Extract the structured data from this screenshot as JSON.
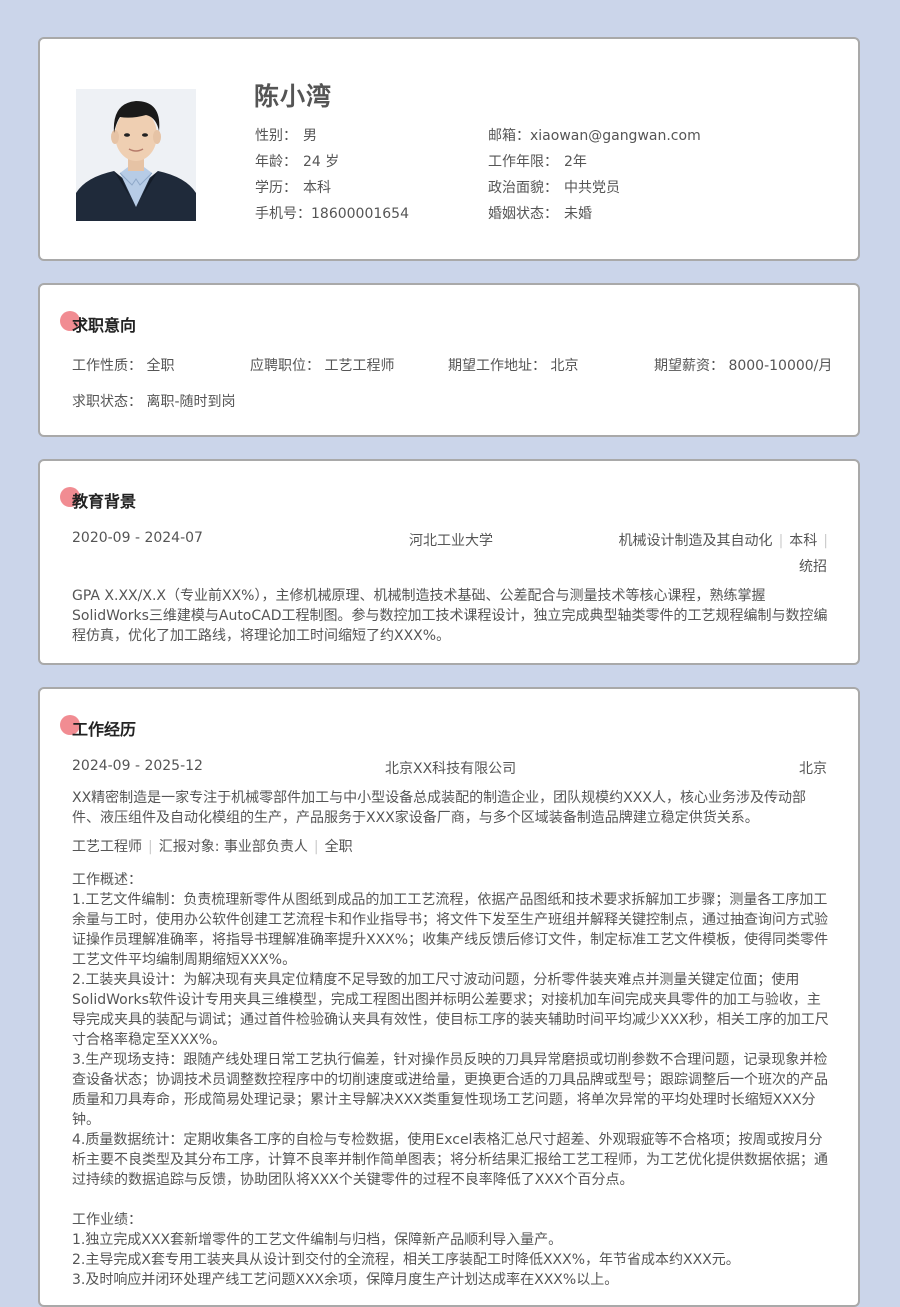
{
  "profile": {
    "name": "陈小湾",
    "gender_label": "性别：",
    "gender": "男",
    "age_label": "年龄：",
    "age": "24 岁",
    "edu_label": "学历：",
    "edu": "本科",
    "phone_label": "手机号：",
    "phone": "18600001654",
    "email_label": "邮箱：",
    "email": "xiaowan@gangwan.com",
    "years_label": "工作年限：",
    "years": "2年",
    "politics_label": "政治面貌：",
    "politics": "中共党员",
    "marital_label": "婚姻状态：",
    "marital": "未婚"
  },
  "intent": {
    "title": "求职意向",
    "type_label": "工作性质：",
    "type": "全职",
    "position_label": "应聘职位：",
    "position": "工艺工程师",
    "location_label": "期望工作地址：",
    "location": "北京",
    "salary_label": "期望薪资：",
    "salary": "8000-10000/月",
    "status_label": "求职状态：",
    "status": "离职-随时到岗"
  },
  "education": {
    "title": "教育背景",
    "period": "2020-09 - 2024-07",
    "school": "河北工业大学",
    "major": "机械设计制造及其自动化",
    "degree": "本科",
    "mode": "统招",
    "description": "GPA X.XX/X.X（专业前XX%），主修机械原理、机械制造技术基础、公差配合与测量技术等核心课程，熟练掌握SolidWorks三维建模与AutoCAD工程制图。参与数控加工技术课程设计，独立完成典型轴类零件的工艺规程编制与数控编程仿真，优化了加工路线，将理论加工时间缩短了约XXX%。"
  },
  "work": {
    "title": "工作经历",
    "period": "2024-09 - 2025-12",
    "company": "北京XX科技有限公司",
    "city": "北京",
    "company_desc": "XX精密制造是一家专注于机械零部件加工与中小型设备总成装配的制造企业，团队规模约XXX人，核心业务涉及传动部件、液压组件及自动化模组的生产，产品服务于XXX家设备厂商，与多个区域装备制造品牌建立稳定供货关系。",
    "role": "工艺工程师",
    "report": "汇报对象: 事业部负责人",
    "job_type": "全职",
    "overview_label": "工作概述：",
    "duties": [
      "1.工艺文件编制：负责梳理新零件从图纸到成品的加工工艺流程，依据产品图纸和技术要求拆解加工步骤；测量各工序加工余量与工时，使用办公软件创建工艺流程卡和作业指导书；将文件下发至生产班组并解释关键控制点，通过抽查询问方式验证操作员理解准确率，将指导书理解准确率提升XXX%；收集产线反馈后修订文件，制定标准工艺文件模板，使得同类零件工艺文件平均编制周期缩短XXX%。",
      "2.工装夹具设计：为解决现有夹具定位精度不足导致的加工尺寸波动问题，分析零件装夹难点并测量关键定位面；使用SolidWorks软件设计专用夹具三维模型，完成工程图出图并标明公差要求；对接机加车间完成夹具零件的加工与验收，主导完成夹具的装配与调试；通过首件检验确认夹具有效性，使目标工序的装夹辅助时间平均减少XXX秒，相关工序的加工尺寸合格率稳定至XXX%。",
      "3.生产现场支持：跟随产线处理日常工艺执行偏差，针对操作员反映的刀具异常磨损或切削参数不合理问题，记录现象并检查设备状态；协调技术员调整数控程序中的切削速度或进给量，更换更合适的刀具品牌或型号；跟踪调整后一个班次的产品质量和刀具寿命，形成简易处理记录；累计主导解决XXX类重复性现场工艺问题，将单次异常的平均处理时长缩短XXX分钟。",
      "4.质量数据统计：定期收集各工序的自检与专检数据，使用Excel表格汇总尺寸超差、外观瑕疵等不合格项；按周或按月分析主要不良类型及其分布工序，计算不良率并制作简单图表；将分析结果汇报给工艺工程师，为工艺优化提供数据依据；通过持续的数据追踪与反馈，协助团队将XXX个关键零件的过程不良率降低了XXX个百分点。"
    ],
    "achievements_label": "工作业绩：",
    "achievements": [
      "1.独立完成XXX套新增零件的工艺文件编制与归档，保障新产品顺利导入量产。",
      "2.主导完成X套专用工装夹具从设计到交付的全流程，相关工序装配工时降低XXX%，年节省成本约XXX元。",
      "3.及时响应并闭环处理产线工艺问题XXX余项，保障月度生产计划达成率在XXX%以上。"
    ]
  }
}
